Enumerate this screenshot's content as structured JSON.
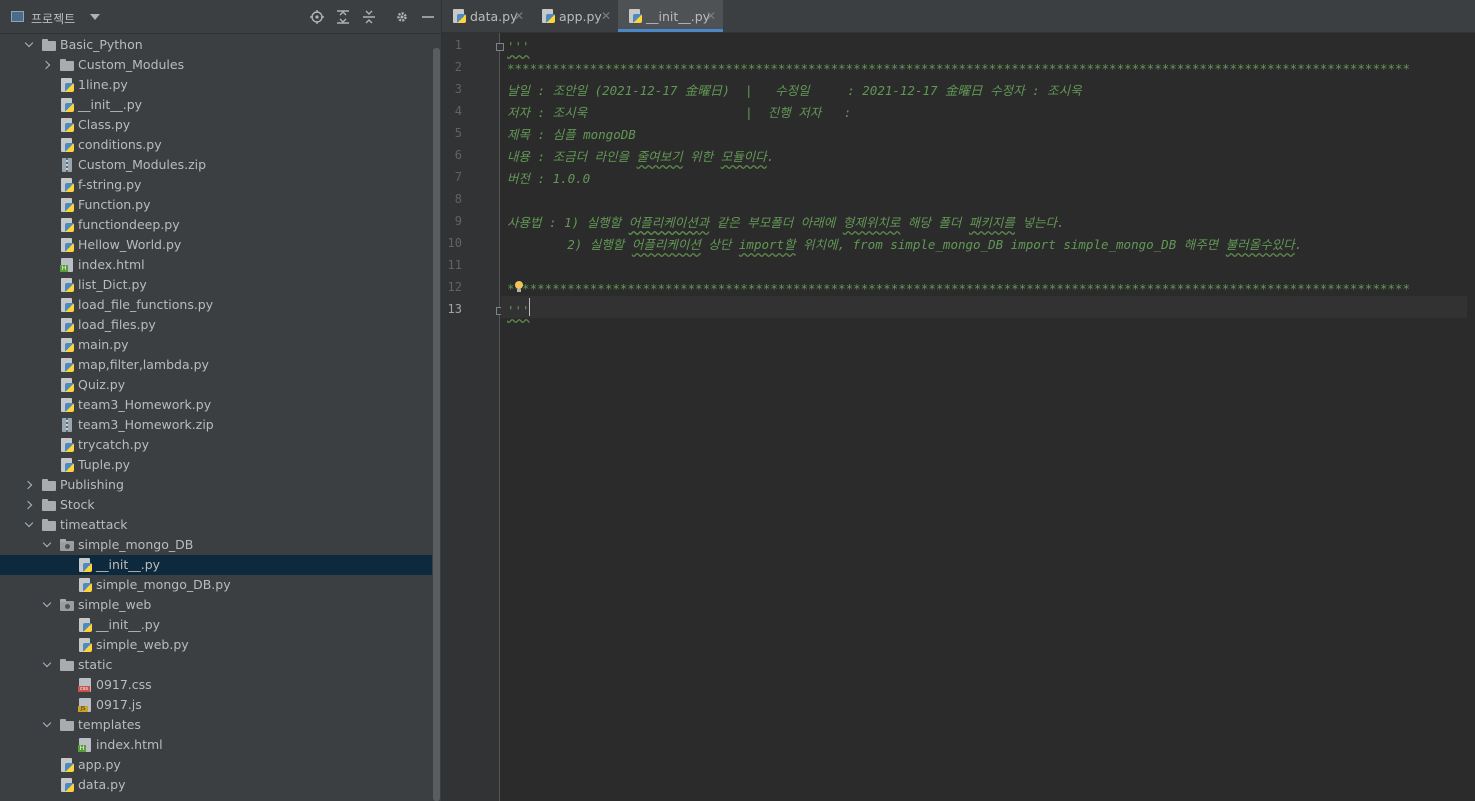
{
  "project_panel": {
    "title": "프로젝트",
    "toolbar_icons": [
      "locate-icon",
      "expand-all-icon",
      "collapse-all-icon",
      "gear-icon",
      "minimize-icon"
    ],
    "tree": [
      {
        "label": "Basic_Python",
        "type": "folder",
        "expanded": true,
        "depth": 1
      },
      {
        "label": "Custom_Modules",
        "type": "folder",
        "expanded": false,
        "depth": 2
      },
      {
        "label": "1line.py",
        "type": "py",
        "depth": 2
      },
      {
        "label": "__init__.py",
        "type": "py",
        "depth": 2
      },
      {
        "label": "Class.py",
        "type": "py",
        "depth": 2
      },
      {
        "label": "conditions.py",
        "type": "py",
        "depth": 2
      },
      {
        "label": "Custom_Modules.zip",
        "type": "zip",
        "depth": 2
      },
      {
        "label": "f-string.py",
        "type": "py",
        "depth": 2
      },
      {
        "label": "Function.py",
        "type": "py",
        "depth": 2
      },
      {
        "label": "functiondeep.py",
        "type": "py",
        "depth": 2
      },
      {
        "label": "Hellow_World.py",
        "type": "py",
        "depth": 2
      },
      {
        "label": "index.html",
        "type": "html",
        "depth": 2
      },
      {
        "label": "list_Dict.py",
        "type": "py",
        "depth": 2
      },
      {
        "label": "load_file_functions.py",
        "type": "py",
        "depth": 2
      },
      {
        "label": "load_files.py",
        "type": "py",
        "depth": 2
      },
      {
        "label": "main.py",
        "type": "py",
        "depth": 2
      },
      {
        "label": "map,filter,lambda.py",
        "type": "py",
        "depth": 2
      },
      {
        "label": "Quiz.py",
        "type": "py",
        "depth": 2
      },
      {
        "label": "team3_Homework.py",
        "type": "py",
        "depth": 2
      },
      {
        "label": "team3_Homework.zip",
        "type": "zip",
        "depth": 2
      },
      {
        "label": "trycatch.py",
        "type": "py",
        "depth": 2
      },
      {
        "label": "Tuple.py",
        "type": "py",
        "depth": 2
      },
      {
        "label": "Publishing",
        "type": "folder",
        "expanded": false,
        "depth": 1
      },
      {
        "label": "Stock",
        "type": "folder",
        "expanded": false,
        "depth": 1
      },
      {
        "label": "timeattack",
        "type": "folder",
        "expanded": true,
        "depth": 1
      },
      {
        "label": "simple_mongo_DB",
        "type": "package",
        "expanded": true,
        "depth": 2
      },
      {
        "label": "__init__.py",
        "type": "py",
        "depth": 3,
        "selected": true
      },
      {
        "label": "simple_mongo_DB.py",
        "type": "py",
        "depth": 3
      },
      {
        "label": "simple_web",
        "type": "package",
        "expanded": true,
        "depth": 2
      },
      {
        "label": "__init__.py",
        "type": "py",
        "depth": 3
      },
      {
        "label": "simple_web.py",
        "type": "py",
        "depth": 3
      },
      {
        "label": "static",
        "type": "folder",
        "expanded": true,
        "depth": 2
      },
      {
        "label": "0917.css",
        "type": "css",
        "depth": 3
      },
      {
        "label": "0917.js",
        "type": "js",
        "depth": 3
      },
      {
        "label": "templates",
        "type": "folder",
        "expanded": true,
        "depth": 2
      },
      {
        "label": "index.html",
        "type": "html",
        "depth": 3
      },
      {
        "label": "app.py",
        "type": "py",
        "depth": 2
      },
      {
        "label": "data.py",
        "type": "py",
        "depth": 2
      }
    ]
  },
  "tabs": [
    {
      "label": "data.py",
      "active": false
    },
    {
      "label": "app.py",
      "active": false
    },
    {
      "label": "__init__.py",
      "active": true
    }
  ],
  "editor": {
    "current_line": 13,
    "lines": [
      "'''",
      "************************************************************************************************************************",
      "날일 : 조안일 (2021-12-17 金曜日)  |   수정일     : 2021-12-17 金曜日 수정자 : 조시욱",
      "저자 : 조시욱                     |  진행 저자   :",
      "제목 : 심플 mongoDB",
      "내용 : 조금더 라인을 줄여보기 위한 모듈이다.",
      "버전 : 1.0.0",
      "",
      "사용법 : 1) 실행할 어플리케이션과 같은 부모폴더 아래에 형제위치로 해당 폴더 패키지를 넣는다.",
      "        2) 실행할 어플리케이션 상단 import할 위치에, from simple_mongo_DB import simple_mongo_DB 해주면 불러올수있다.",
      "",
      "************************************************************************************************************************",
      "'''"
    ]
  },
  "colors": {
    "panel_bg": "#3c3f41",
    "editor_bg": "#2b2b2b",
    "docstring": "#629755",
    "selection": "#0d293e",
    "tab_accent": "#4a88c7"
  }
}
